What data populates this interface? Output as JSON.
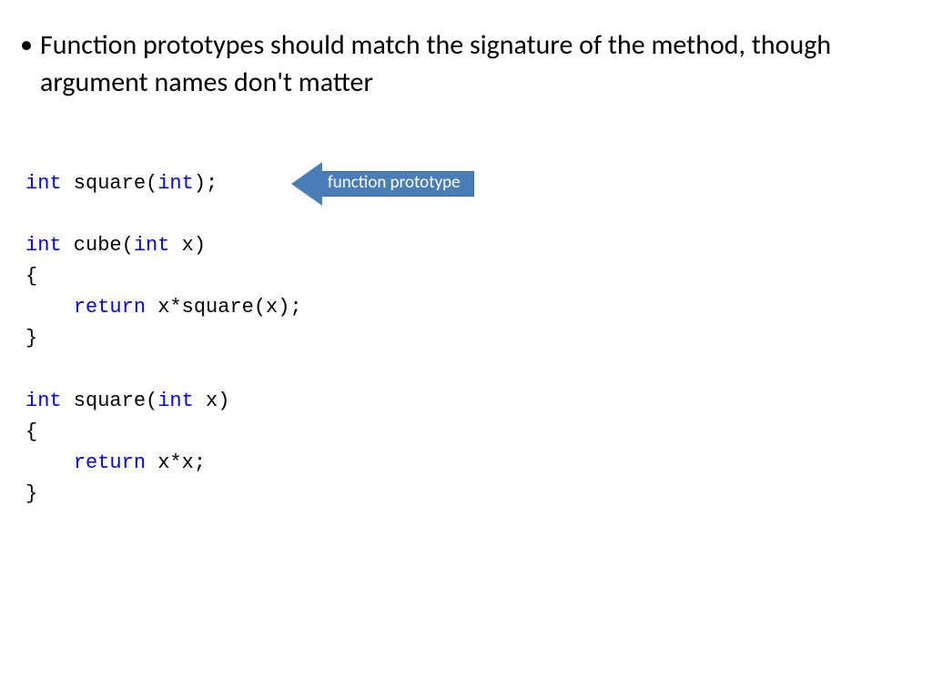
{
  "bullet": {
    "text": "Function prototypes should match the signature of the method, though argument names don't matter"
  },
  "code": {
    "line1_kw1": "int",
    "line1_txt1": " square(",
    "line1_kw2": "int",
    "line1_txt2": ");",
    "line3_kw1": "int",
    "line3_txt1": " cube(",
    "line3_kw2": "int",
    "line3_txt2": " x)",
    "line4": "{",
    "line5_indent": "    ",
    "line5_kw": "return",
    "line5_txt": " x*square(x);",
    "line6": "}",
    "line8_kw1": "int",
    "line8_txt1": " square(",
    "line8_kw2": "int",
    "line8_txt2": " x)",
    "line9": "{",
    "line10_indent": "    ",
    "line10_kw": "return",
    "line10_txt": " x*x;",
    "line11": "}"
  },
  "callout": {
    "label": "function prototype"
  }
}
